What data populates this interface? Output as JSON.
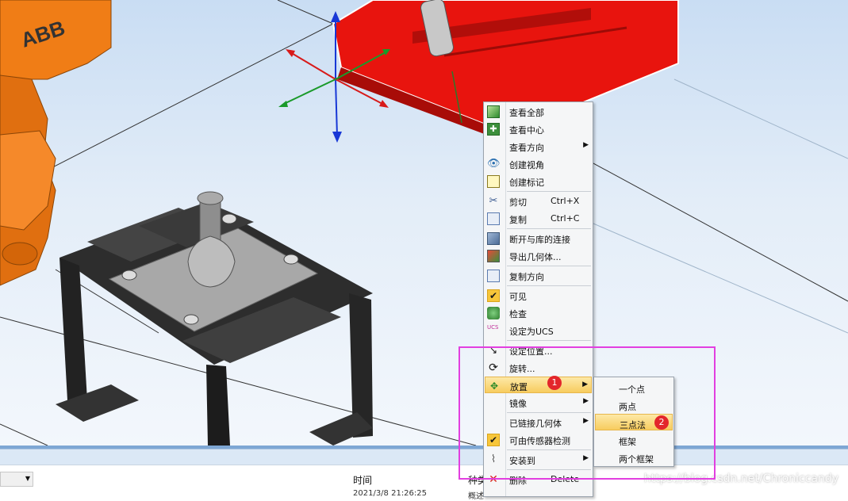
{
  "viewport": {
    "abb_logo": "ABB"
  },
  "context_menu": {
    "items": [
      {
        "label": "查看全部",
        "icon": "view-all-icon"
      },
      {
        "label": "查看中心",
        "icon": "view-center-icon"
      },
      {
        "label": "查看方向",
        "icon": "",
        "submenu": true
      },
      {
        "label": "创建视角",
        "icon": "create-viewpoint-icon"
      },
      {
        "label": "创建标记",
        "icon": "create-marker-icon"
      },
      {
        "label": "剪切",
        "shortcut": "Ctrl+X",
        "icon": "cut-icon"
      },
      {
        "label": "复制",
        "shortcut": "Ctrl+C",
        "icon": "copy-icon"
      },
      {
        "label": "断开与库的连接",
        "icon": "disconnect-library-icon"
      },
      {
        "label": "导出几何体...",
        "icon": "export-geometry-icon"
      },
      {
        "label": "复制方向",
        "icon": "copy-orientation-icon"
      },
      {
        "label": "可见",
        "icon": "checkmark-icon",
        "checked": true
      },
      {
        "label": "检查",
        "icon": "inspect-icon"
      },
      {
        "label": "设定为UCS",
        "icon": "ucs-icon"
      },
      {
        "label": "设定位置...",
        "icon": "set-position-icon"
      },
      {
        "label": "旋转...",
        "icon": "rotate-icon"
      },
      {
        "label": "放置",
        "icon": "place-icon",
        "submenu": true,
        "highlighted": true
      },
      {
        "label": "镜像",
        "icon": "",
        "submenu": true
      },
      {
        "label": "已链接几何体",
        "icon": "",
        "submenu": true
      },
      {
        "label": "可由传感器检测",
        "icon": "checkmark-icon",
        "checked": true
      },
      {
        "label": "安装到",
        "icon": "attach-icon",
        "submenu": true
      },
      {
        "label": "删除",
        "shortcut": "Delete",
        "icon": "delete-icon"
      }
    ]
  },
  "place_submenu": {
    "items": [
      {
        "label": "一个点"
      },
      {
        "label": "两点"
      },
      {
        "label": "三点法",
        "highlighted": true
      },
      {
        "label": "框架"
      },
      {
        "label": "两个框架"
      }
    ]
  },
  "badges": {
    "place_step": "1",
    "three_point_step": "2"
  },
  "output_panel": {
    "columns": [
      "时间",
      "种类"
    ],
    "first_row": {
      "time": "2021/3/8 21:26:25",
      "category": "概述"
    }
  },
  "watermark": "https://blog.csdn.net/Chroniccandy",
  "colors": {
    "highlight_box": "#e23fe0",
    "menu_highlight": "#f7cc5e",
    "badge": "#e3262b",
    "workpiece": "#e8140e",
    "robot": "#f07d16"
  }
}
